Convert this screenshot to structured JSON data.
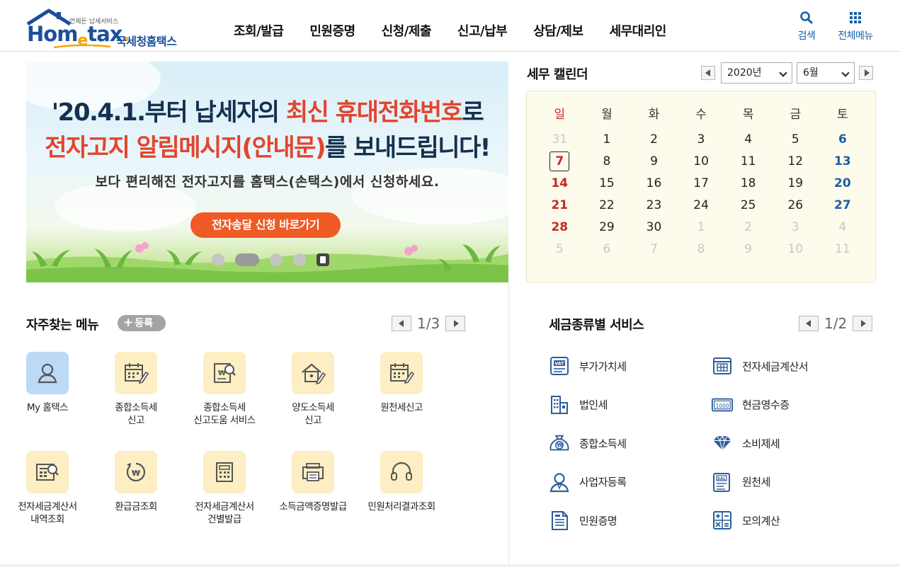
{
  "header": {
    "logo_tagline": "언제든 납세서비스",
    "logo_word": "Hometax",
    "logo_korean": "국세청홈택스",
    "nav": [
      "조회/발급",
      "민원증명",
      "신청/제출",
      "신고/납부",
      "상담/제보",
      "세무대리인"
    ],
    "search_label": "검색",
    "menu_label": "전체메뉴",
    "accent_color": "#1a5ea8"
  },
  "banner": {
    "line1_pre": "'20.4.1.부터 납세자의 ",
    "line1_red": "최신 휴대전화번호",
    "line1_post": "로",
    "line2_red": "전자고지 알림메시지(안내문)",
    "line2_post": "를 보내드립니다!",
    "subtitle": "보다 편리해진 전자고지를 홈택스(손택스)에서 신청하세요.",
    "cta": "전자송달 신청 바로가기",
    "slide_count": 4,
    "active_slide": 2
  },
  "calendar": {
    "title": "세무 캘린더",
    "year": "2020년",
    "month": "6월",
    "weekdays": [
      "일",
      "월",
      "화",
      "수",
      "목",
      "금",
      "토"
    ],
    "today": "7",
    "weeks": [
      [
        "31",
        "1",
        "2",
        "3",
        "4",
        "5",
        "6"
      ],
      [
        "7",
        "8",
        "9",
        "10",
        "11",
        "12",
        "13"
      ],
      [
        "14",
        "15",
        "16",
        "17",
        "18",
        "19",
        "20"
      ],
      [
        "21",
        "22",
        "23",
        "24",
        "25",
        "26",
        "27"
      ],
      [
        "28",
        "29",
        "30",
        "1",
        "2",
        "3",
        "4"
      ],
      [
        "5",
        "6",
        "7",
        "8",
        "9",
        "10",
        "11"
      ]
    ]
  },
  "favorites": {
    "title": "자주찾는 메뉴",
    "register": "등록",
    "page": "1/3",
    "items": [
      {
        "label": "My 홈택스",
        "icon": "user-icon"
      },
      {
        "label": "종합소득세\n신고",
        "icon": "calendar-pen-icon"
      },
      {
        "label": "종합소득세\n신고도움 서비스",
        "icon": "document-search-icon"
      },
      {
        "label": "양도소득세\n신고",
        "icon": "house-pen-icon"
      },
      {
        "label": "원천세신고",
        "icon": "calendar-pen-icon"
      },
      {
        "label": "전자세금계산서\n내역조회",
        "icon": "invoice-search-icon"
      },
      {
        "label": "환급금조회",
        "icon": "refund-icon"
      },
      {
        "label": "전자세금계산서\n건별발급",
        "icon": "calculator-icon"
      },
      {
        "label": "소득금액증명발급",
        "icon": "printer-icon"
      },
      {
        "label": "민원처리결과조회",
        "icon": "headset-icon"
      }
    ]
  },
  "tax_services": {
    "title": "세금종류별 서비스",
    "page": "1/2",
    "items": [
      {
        "label": "부가가치세",
        "icon": "vat-icon"
      },
      {
        "label": "전자세금계산서",
        "icon": "e-invoice-icon"
      },
      {
        "label": "법인세",
        "icon": "building-icon"
      },
      {
        "label": "현금영수증",
        "icon": "cash-receipt-icon"
      },
      {
        "label": "종합소득세",
        "icon": "money-bag-icon"
      },
      {
        "label": "소비제세",
        "icon": "diamond-icon"
      },
      {
        "label": "사업자등록",
        "icon": "person-icon"
      },
      {
        "label": "원천세",
        "icon": "salary-icon"
      },
      {
        "label": "민원증명",
        "icon": "certificate-icon"
      },
      {
        "label": "모의계산",
        "icon": "calculator-icon"
      }
    ]
  }
}
